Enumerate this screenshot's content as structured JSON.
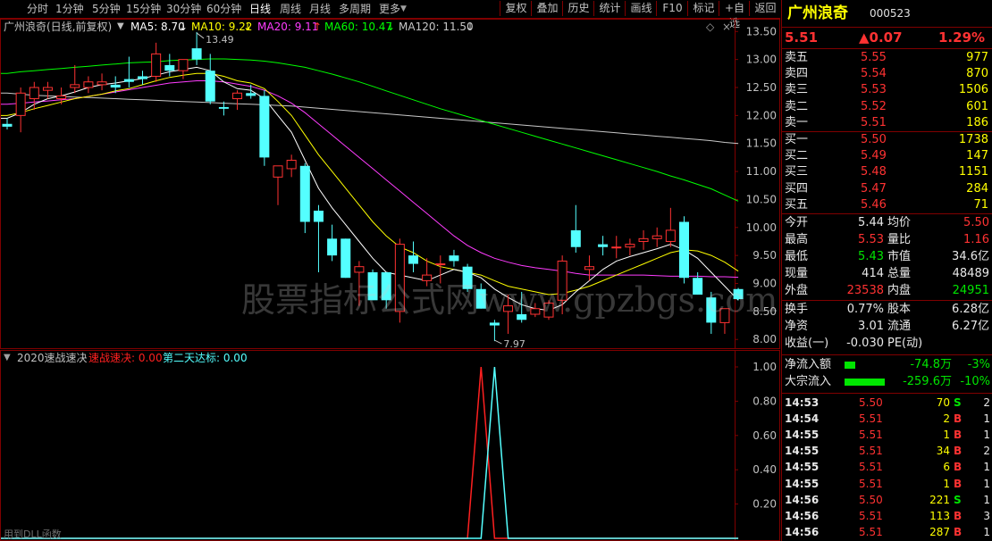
{
  "toolbar": {
    "periods": [
      "分时",
      "1分钟",
      "5分钟",
      "15分钟",
      "30分钟",
      "60分钟",
      "日线",
      "周线",
      "月线",
      "多周期",
      "更多"
    ],
    "active": "日线",
    "actions": [
      "复权",
      "叠加",
      "历史",
      "统计",
      "画线",
      "F10",
      "标记",
      "+自选",
      "返回"
    ]
  },
  "main_legend": {
    "title": "广州浪奇(日线,前复权)",
    "ma5": "MA5: 8.70",
    "ma10": "MA10: 9.22",
    "ma20": "MA20: 9.11",
    "ma60": "MA60: 10.47",
    "ma120": "MA120: 11.50"
  },
  "sub_legend": {
    "title": "2020速战速决",
    "s1": "速战速决: 0.00",
    "s2": "第二天达标: 0.00"
  },
  "annotations": {
    "high": "13.49",
    "low": "7.97"
  },
  "watermark": "股票指标公式网www.gpzbgs.com",
  "footer": "用到DLL函数",
  "colors": {
    "up": "#ff3232",
    "down": "#54ffff",
    "ma5": "#ffffff",
    "ma10": "#ffff00",
    "ma20": "#ff3cff",
    "ma60": "#00ff00",
    "ma120": "#c8c8c8",
    "sig1": "#ff2020",
    "sig2": "#54ffff"
  },
  "chart_data": [
    {
      "type": "candlestick",
      "title": "广州浪奇(日线,前复权)",
      "y_ticks": [
        "13.50",
        "13.00",
        "12.50",
        "12.00",
        "11.50",
        "11.00",
        "10.50",
        "10.00",
        "9.50",
        "9.00",
        "8.50",
        "8.00"
      ],
      "ylim": [
        7.86,
        13.68
      ],
      "candles": [
        [
          11.85,
          11.95,
          11.75,
          11.8
        ],
        [
          12.0,
          12.5,
          11.7,
          12.4
        ],
        [
          12.3,
          12.6,
          12.1,
          12.5
        ],
        [
          12.45,
          12.6,
          12.3,
          12.5
        ],
        [
          12.3,
          12.5,
          12.2,
          12.35
        ],
        [
          12.5,
          12.9,
          12.4,
          12.55
        ],
        [
          12.5,
          12.7,
          12.4,
          12.6
        ],
        [
          12.55,
          12.75,
          12.45,
          12.6
        ],
        [
          12.55,
          12.7,
          12.4,
          12.5
        ],
        [
          12.65,
          13.05,
          12.5,
          12.6
        ],
        [
          12.7,
          12.8,
          12.55,
          12.65
        ],
        [
          12.7,
          13.3,
          12.6,
          13.1
        ],
        [
          12.9,
          13.1,
          12.7,
          12.8
        ],
        [
          12.8,
          13.0,
          12.65,
          13.0
        ],
        [
          13.2,
          13.49,
          12.9,
          13.0
        ],
        [
          12.8,
          13.1,
          12.2,
          12.25
        ],
        [
          12.15,
          12.25,
          12.0,
          12.12
        ],
        [
          12.3,
          12.45,
          12.1,
          12.4
        ],
        [
          12.4,
          12.55,
          12.3,
          12.35
        ],
        [
          12.35,
          12.45,
          11.1,
          11.25
        ],
        [
          10.9,
          11.1,
          10.4,
          11.1
        ],
        [
          11.05,
          11.3,
          10.9,
          11.2
        ],
        [
          11.1,
          11.15,
          9.9,
          10.1
        ],
        [
          10.3,
          10.4,
          9.2,
          10.1
        ],
        [
          9.8,
          10.05,
          9.4,
          9.5
        ],
        [
          9.8,
          9.8,
          9.1,
          9.1
        ],
        [
          9.2,
          9.4,
          8.6,
          9.3
        ],
        [
          9.2,
          9.25,
          8.7,
          8.7
        ],
        [
          9.2,
          9.2,
          8.55,
          8.7
        ],
        [
          8.5,
          9.8,
          8.3,
          9.7
        ],
        [
          9.5,
          9.75,
          9.2,
          9.35
        ],
        [
          9.05,
          9.45,
          8.95,
          9.15
        ],
        [
          9.35,
          9.5,
          9.0,
          9.35
        ],
        [
          9.5,
          9.6,
          9.3,
          9.4
        ],
        [
          9.3,
          9.35,
          8.85,
          8.9
        ],
        [
          8.9,
          9.0,
          8.55,
          8.55
        ],
        [
          8.3,
          8.35,
          7.97,
          8.25
        ],
        [
          8.5,
          8.8,
          8.1,
          8.6
        ],
        [
          8.45,
          8.85,
          8.3,
          8.35
        ],
        [
          8.45,
          8.65,
          8.4,
          8.55
        ],
        [
          8.4,
          8.7,
          8.35,
          8.65
        ],
        [
          8.7,
          9.5,
          8.45,
          9.4
        ],
        [
          9.95,
          10.4,
          9.55,
          9.65
        ],
        [
          9.25,
          9.5,
          9.05,
          9.3
        ],
        [
          9.7,
          9.85,
          9.5,
          9.65
        ],
        [
          9.65,
          9.85,
          9.45,
          9.65
        ],
        [
          9.65,
          9.8,
          9.5,
          9.7
        ],
        [
          9.75,
          9.95,
          9.6,
          9.8
        ],
        [
          9.8,
          10.0,
          9.65,
          9.85
        ],
        [
          9.75,
          10.35,
          9.65,
          9.95
        ],
        [
          10.1,
          10.2,
          9.0,
          9.1
        ],
        [
          9.1,
          9.2,
          8.8,
          8.8
        ],
        [
          8.75,
          8.85,
          8.1,
          8.3
        ],
        [
          8.3,
          8.55,
          8.1,
          8.55
        ],
        [
          8.9,
          8.92,
          8.7,
          8.72
        ]
      ],
      "ma5": [
        11.95,
        12.05,
        12.2,
        12.3,
        12.35,
        12.42,
        12.5,
        12.55,
        12.58,
        12.62,
        12.66,
        12.72,
        12.78,
        12.82,
        12.86,
        12.8,
        12.6,
        12.48,
        12.45,
        12.3,
        12.0,
        11.7,
        11.2,
        10.7,
        10.35,
        10.05,
        9.75,
        9.45,
        9.2,
        9.15,
        9.1,
        9.05,
        9.15,
        9.25,
        9.2,
        9.1,
        8.9,
        8.75,
        8.62,
        8.55,
        8.52,
        8.62,
        8.85,
        9.05,
        9.25,
        9.4,
        9.48,
        9.55,
        9.62,
        9.7,
        9.6,
        9.45,
        9.2,
        8.95,
        8.7
      ],
      "ma10": [
        12.0,
        12.05,
        12.12,
        12.18,
        12.24,
        12.3,
        12.34,
        12.38,
        12.44,
        12.48,
        12.55,
        12.62,
        12.68,
        12.72,
        12.75,
        12.75,
        12.7,
        12.62,
        12.58,
        12.48,
        12.25,
        12.0,
        11.65,
        11.3,
        11.0,
        10.7,
        10.4,
        10.1,
        9.85,
        9.65,
        9.55,
        9.4,
        9.3,
        9.25,
        9.2,
        9.15,
        9.05,
        8.95,
        8.9,
        8.85,
        8.8,
        8.82,
        8.88,
        8.95,
        9.05,
        9.15,
        9.25,
        9.35,
        9.45,
        9.55,
        9.6,
        9.58,
        9.5,
        9.38,
        9.22
      ],
      "ma20": [
        12.2,
        12.22,
        12.24,
        12.26,
        12.28,
        12.3,
        12.34,
        12.38,
        12.42,
        12.46,
        12.5,
        12.54,
        12.58,
        12.6,
        12.62,
        12.62,
        12.6,
        12.56,
        12.52,
        12.45,
        12.35,
        12.22,
        12.05,
        11.85,
        11.65,
        11.45,
        11.25,
        11.05,
        10.85,
        10.65,
        10.45,
        10.25,
        10.05,
        9.85,
        9.68,
        9.55,
        9.45,
        9.38,
        9.32,
        9.28,
        9.25,
        9.22,
        9.18,
        9.15,
        9.15,
        9.15,
        9.15,
        9.15,
        9.14,
        9.13,
        9.13,
        9.13,
        9.12,
        9.12,
        9.11
      ],
      "ma60": [
        12.75,
        12.78,
        12.8,
        12.82,
        12.84,
        12.86,
        12.88,
        12.9,
        12.92,
        12.94,
        12.95,
        12.96,
        12.98,
        12.99,
        13.0,
        13.01,
        13.01,
        13.0,
        12.99,
        12.97,
        12.94,
        12.9,
        12.86,
        12.8,
        12.74,
        12.67,
        12.6,
        12.52,
        12.44,
        12.36,
        12.28,
        12.2,
        12.12,
        12.05,
        11.98,
        11.91,
        11.84,
        11.77,
        11.7,
        11.63,
        11.56,
        11.49,
        11.42,
        11.35,
        11.28,
        11.21,
        11.14,
        11.07,
        11.0,
        10.92,
        10.85,
        10.77,
        10.69,
        10.58,
        10.47
      ],
      "ma120": [
        12.4,
        12.38,
        12.36,
        12.35,
        12.34,
        12.33,
        12.32,
        12.31,
        12.3,
        12.29,
        12.28,
        12.27,
        12.26,
        12.25,
        12.24,
        12.23,
        12.22,
        12.21,
        12.2,
        12.19,
        12.18,
        12.17,
        12.15,
        12.13,
        12.11,
        12.09,
        12.07,
        12.05,
        12.03,
        12.01,
        11.99,
        11.97,
        11.95,
        11.93,
        11.91,
        11.89,
        11.87,
        11.85,
        11.83,
        11.81,
        11.79,
        11.77,
        11.75,
        11.73,
        11.71,
        11.69,
        11.67,
        11.65,
        11.63,
        11.61,
        11.59,
        11.57,
        11.55,
        11.52,
        11.5
      ]
    },
    {
      "type": "line",
      "title": "2020速战速决",
      "y_ticks": [
        "1.00",
        "0.80",
        "0.60",
        "0.40",
        "0.20"
      ],
      "ylim": [
        0,
        1
      ],
      "series": [
        {
          "name": "速战速决",
          "values": [
            0,
            0,
            0,
            0,
            0,
            0,
            0,
            0,
            0,
            0,
            0,
            0,
            0,
            0,
            0,
            0,
            0,
            0,
            0,
            0,
            0,
            0,
            0,
            0,
            0,
            0,
            0,
            0,
            0,
            0,
            0,
            0,
            0,
            0,
            0,
            1,
            0,
            0,
            0,
            0,
            0,
            0,
            0,
            0,
            0,
            0,
            0,
            0,
            0,
            0,
            0,
            0,
            0,
            0,
            0
          ]
        },
        {
          "name": "第二天达标",
          "values": [
            0,
            0,
            0,
            0,
            0,
            0,
            0,
            0,
            0,
            0,
            0,
            0,
            0,
            0,
            0,
            0,
            0,
            0,
            0,
            0,
            0,
            0,
            0,
            0,
            0,
            0,
            0,
            0,
            0,
            0,
            0,
            0,
            0,
            0,
            0,
            0,
            1,
            0,
            0,
            0,
            0,
            0,
            0,
            0,
            0,
            0,
            0,
            0,
            0,
            0,
            0,
            0,
            0,
            0,
            0
          ]
        }
      ]
    }
  ],
  "quote": {
    "name": "广州浪奇",
    "code": "000523",
    "price": "5.51",
    "change": "▲0.07",
    "pct": "1.29%",
    "asks": [
      {
        "label": "卖五",
        "price": "5.55",
        "vol": "977"
      },
      {
        "label": "卖四",
        "price": "5.54",
        "vol": "870"
      },
      {
        "label": "卖三",
        "price": "5.53",
        "vol": "1506"
      },
      {
        "label": "卖二",
        "price": "5.52",
        "vol": "601"
      },
      {
        "label": "卖一",
        "price": "5.51",
        "vol": "186"
      }
    ],
    "bids": [
      {
        "label": "买一",
        "price": "5.50",
        "vol": "1738"
      },
      {
        "label": "买二",
        "price": "5.49",
        "vol": "147"
      },
      {
        "label": "买三",
        "price": "5.48",
        "vol": "1151"
      },
      {
        "label": "买四",
        "price": "5.47",
        "vol": "284"
      },
      {
        "label": "买五",
        "price": "5.46",
        "vol": "71"
      }
    ],
    "stats": [
      {
        "l1": "今开",
        "v1": "5.44",
        "c1": "white",
        "l2": "均价",
        "v2": "5.50",
        "c2": "red"
      },
      {
        "l1": "最高",
        "v1": "5.53",
        "c1": "red",
        "l2": "量比",
        "v2": "1.16",
        "c2": "red"
      },
      {
        "l1": "最低",
        "v1": "5.43",
        "c1": "green",
        "l2": "市值",
        "v2": "34.6亿",
        "c2": "white"
      },
      {
        "l1": "现量",
        "v1": "414",
        "c1": "white",
        "l2": "总量",
        "v2": "48489",
        "c2": "white"
      },
      {
        "l1": "外盘",
        "v1": "23538",
        "c1": "red",
        "l2": "内盘",
        "v2": "24951",
        "c2": "green"
      }
    ],
    "stats2": [
      {
        "l1": "换手",
        "v1": "0.77%",
        "l2": "股本",
        "v2": "6.28亿"
      },
      {
        "l1": "净资",
        "v1": "3.01",
        "l2": "流通",
        "v2": "6.27亿"
      },
      {
        "l1": "收益(一)",
        "v1": "-0.030",
        "l2": "PE(动)",
        "v2": ""
      }
    ],
    "flows": [
      {
        "label": "净流入额",
        "value": "-74.8万",
        "pct": "-3%",
        "bar": 0.12
      },
      {
        "label": "大宗流入",
        "value": "-259.6万",
        "pct": "-10%",
        "bar": 0.45
      }
    ],
    "ticks": [
      {
        "time": "14:53",
        "price": "5.50",
        "vol": "70",
        "side": "S",
        "n": "2"
      },
      {
        "time": "14:54",
        "price": "5.51",
        "vol": "2",
        "side": "B",
        "n": "1"
      },
      {
        "time": "14:55",
        "price": "5.51",
        "vol": "1",
        "side": "B",
        "n": "1"
      },
      {
        "time": "14:55",
        "price": "5.51",
        "vol": "34",
        "side": "B",
        "n": "2"
      },
      {
        "time": "14:55",
        "price": "5.51",
        "vol": "6",
        "side": "B",
        "n": "1"
      },
      {
        "time": "14:55",
        "price": "5.51",
        "vol": "1",
        "side": "B",
        "n": "1"
      },
      {
        "time": "14:56",
        "price": "5.50",
        "vol": "221",
        "side": "S",
        "n": "1"
      },
      {
        "time": "14:56",
        "price": "5.51",
        "vol": "113",
        "side": "B",
        "n": "3"
      },
      {
        "time": "14:56",
        "price": "5.51",
        "vol": "287",
        "side": "B",
        "n": "1"
      }
    ]
  }
}
